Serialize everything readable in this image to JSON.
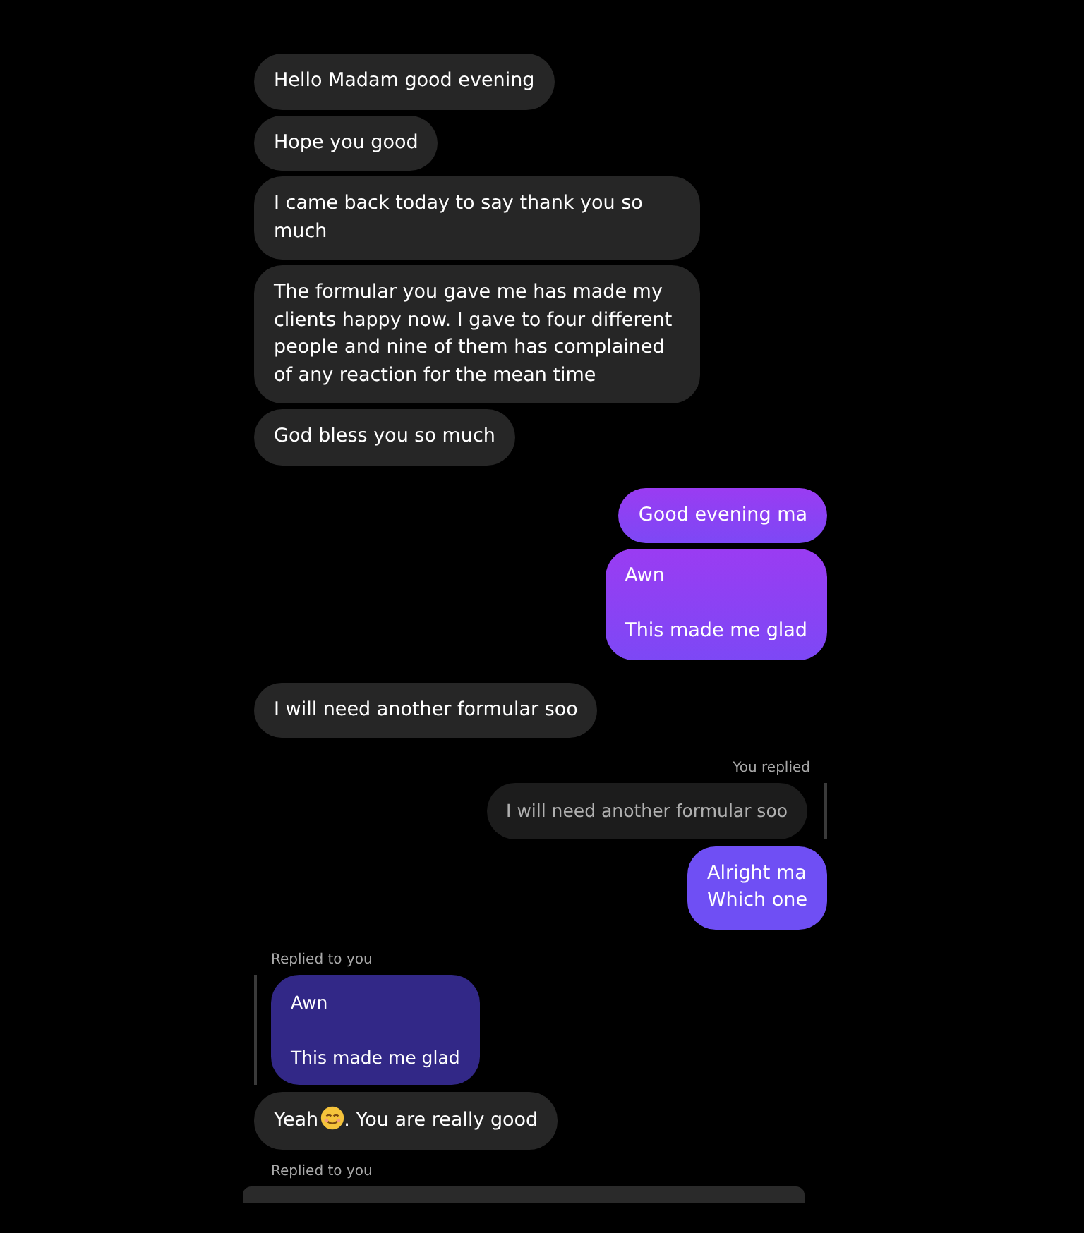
{
  "messages": [
    {
      "kind": "incoming",
      "lines": [
        "Hello Madam good evening"
      ]
    },
    {
      "kind": "incoming",
      "lines": [
        "Hope you good"
      ]
    },
    {
      "kind": "incoming",
      "lines": [
        "I came back today to say thank you so much"
      ]
    },
    {
      "kind": "incoming",
      "lines": [
        "The formular you gave me has made my clients happy now. I gave to four different people and nine of them has complained of any reaction for the mean time"
      ]
    },
    {
      "kind": "incoming",
      "lines": [
        "God bless you so much"
      ]
    },
    {
      "kind": "outgoing",
      "lines": [
        "Good evening ma"
      ]
    },
    {
      "kind": "outgoing",
      "lines": [
        "Awn",
        "This made me glad"
      ]
    },
    {
      "kind": "incoming",
      "lines": [
        "I will need another formular soo"
      ]
    },
    {
      "kind": "reply_sent",
      "label": "You replied",
      "quote": [
        "I will need another formular soo"
      ],
      "lines": [
        "Alright ma",
        "Which one"
      ]
    },
    {
      "kind": "reply_received",
      "label": "Replied to you",
      "quote": [
        "Awn",
        "This made me glad"
      ],
      "before": "Yeah",
      "after": ". You are really good"
    },
    {
      "kind": "reply_partial",
      "label": "Replied to you"
    }
  ]
}
